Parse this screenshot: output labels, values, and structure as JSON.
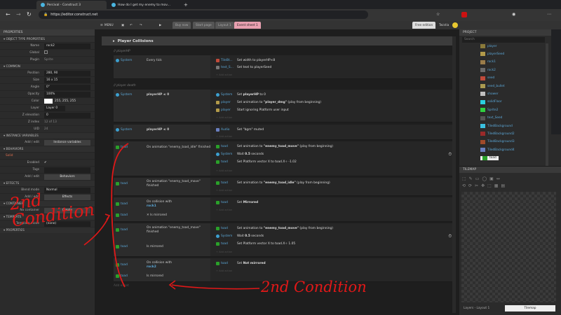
{
  "browser": {
    "tabs": [
      "Percival - Construct 3",
      "How do I get my enemy to mov..."
    ],
    "url": "https://editor.construct.net"
  },
  "toolbar": {
    "menu": "MENU",
    "doc_tabs": [
      "Buy now",
      "Start page",
      "Layout 1",
      "Event sheet 1"
    ],
    "edition": "Free edition",
    "user": "Twistia"
  },
  "properties": {
    "title": "PROPERTIES",
    "object_type_header": "OBJECT TYPE PROPERTIES",
    "name_label": "Name",
    "name_value": "rock2",
    "global_label": "Global",
    "plugin_label": "Plugin",
    "plugin_value": "Sprite",
    "common_header": "COMMON",
    "rows": [
      {
        "label": "Position",
        "value": "280, 90"
      },
      {
        "label": "Size",
        "value": "16 x 15"
      },
      {
        "label": "Angle",
        "value": "0°"
      },
      {
        "label": "Opacity",
        "value": "100%"
      },
      {
        "label": "Color",
        "value": "255, 255, 255"
      },
      {
        "label": "Layer",
        "value": "Layer 0"
      },
      {
        "label": "Z elevation",
        "value": "0"
      },
      {
        "label": "Z index",
        "value": "12 of 13"
      },
      {
        "label": "UID",
        "value": "24"
      }
    ],
    "instance_vars_header": "INSTANCE VARIABLES",
    "instance_vars_edit": "Add / edit",
    "instance_vars_btn": "Instance variables",
    "behaviors_header": "BEHAVIORS",
    "behavior_name": "Solid",
    "enabled_label": "Enabled",
    "tags_label": "Tags",
    "behaviors_edit": "Add / edit",
    "behaviors_btn": "Behaviors",
    "effects_header": "EFFECTS",
    "blend_label": "Blend mode",
    "blend_value": "Normal",
    "effects_edit": "Add / edit",
    "effects_btn": "Effects",
    "container_header": "CONTAINER",
    "no_container": "No container",
    "create_btn": "Create",
    "template_header": "TEMPLATE",
    "template_mode_label": "Template mode",
    "template_mode_value": "(none)",
    "properties_header": "PROPERTIES"
  },
  "events": {
    "group_title": "Player Collisions",
    "comment_playerhp": "// playerHP",
    "comment_death": "// player death",
    "add_action": "+ Add action",
    "add": "+ Add...",
    "e1": {
      "num": "17",
      "obj": "System",
      "cond": "Every tick",
      "a1_obj": "TileBt...",
      "a1": "Set width to playerHP×8",
      "a2_obj": "text_S...",
      "a2": "Set text to playerSeed"
    },
    "e2": {
      "num": "19",
      "obj": "System",
      "cond": "playerHP ≤ 0",
      "a1_obj": "System",
      "a1_pre": "Set ",
      "a1_b": "playerHP",
      "a1_post": " to 0",
      "a2_obj": "player",
      "a2_pre": "Set animation to ",
      "a2_b": "\"player_dmg\"",
      "a2_post": " (play from beginning)",
      "a3_obj": "player",
      "a3": "Start ignoring  Platform user input"
    },
    "e3": {
      "num": "20",
      "obj": "System",
      "cond": "playerHP ≤ 0",
      "a1_obj": "Audio",
      "a1": "Set \"bgm\" muted"
    },
    "e4": {
      "num": "21",
      "obj": "toad",
      "cond": "On animation \"enemy_toad_idle\" finished",
      "a1_obj": "toad",
      "a1_pre": "Set animation to ",
      "a1_b": "\"enemy_toad_move\"",
      "a1_post": " (play from beginning)",
      "a2_obj": "System",
      "a2_pre": "Wait ",
      "a2_b": "0.5",
      "a2_post": " seconds",
      "a3_obj": "toad",
      "a3": "Set  Platform vector X to toad.X÷ -1.02"
    },
    "e5": {
      "num": "22",
      "obj": "toad",
      "cond": "On animation \"enemy_toad_move\" finished",
      "a1_obj": "toad",
      "a1_pre": "Set animation to ",
      "a1_b": "\"enemy_toad_idle\"",
      "a1_post": " (play from beginning)"
    },
    "e6": {
      "num": "23",
      "obj": "toad",
      "cond": "On collision with",
      "cond_b": "rock1",
      "c2_obj": "toad",
      "c2": "✕ Is mirrored",
      "a1_obj": "toad",
      "a1_pre": "Set ",
      "a1_b": "Mirrored",
      "a1_post": ""
    },
    "e7": {
      "num": "24",
      "obj": "toad",
      "cond": "On animation \"enemy_toad_move\" finished",
      "c2_obj": "toad",
      "c2": "Is mirrored",
      "a1_obj": "toad",
      "a1_pre": "Set animation to ",
      "a1_b": "\"enemy_toad_move\"",
      "a1_post": " (play from beginning)",
      "a2_obj": "System",
      "a2_pre": "Wait ",
      "a2_b": "0.5",
      "a2_post": " seconds",
      "a3_obj": "toad",
      "a3": "Set  Platform vector X to toad.X÷ 1.05"
    },
    "e8": {
      "num": "25",
      "obj": "toad",
      "cond": "On collision with",
      "cond_b": "rock2",
      "c2_obj": "toad",
      "c2": "Is mirrored",
      "a1_obj": "toad",
      "a1_pre": "Set ",
      "a1_b": "Not mirrored",
      "a1_post": ""
    },
    "add_event": "Add event"
  },
  "project": {
    "title": "PROJECT",
    "search_placeholder": "Search",
    "items": [
      "player",
      "playerSeed",
      "rock1",
      "rock2",
      "seed",
      "seed_bullet",
      "shower",
      "solidFloor",
      "Sprite2",
      "text_Seed",
      "TiledBackground",
      "TiledBackground2",
      "TiledBackground3",
      "TiledBackground4",
      "toad"
    ],
    "item_colors": [
      "#8a7a3a",
      "#b29a4a",
      "#9a7c4a",
      "#6b6b6b",
      "#c04a3a",
      "#aa9a50",
      "#c0c0c0",
      "#2ad0e0",
      "#30d040",
      "#555",
      "#3ac0e0",
      "#9a2a2a",
      "#a04a2a",
      "#6a7fc0",
      "#2aa02a"
    ]
  },
  "tilemap": {
    "title": "TILEMAP",
    "footer_tabs": [
      "Layers - Layout 1",
      "Tilemap"
    ]
  },
  "annotations": {
    "left": "2nd Condition",
    "bottom": "2nd Condition"
  }
}
